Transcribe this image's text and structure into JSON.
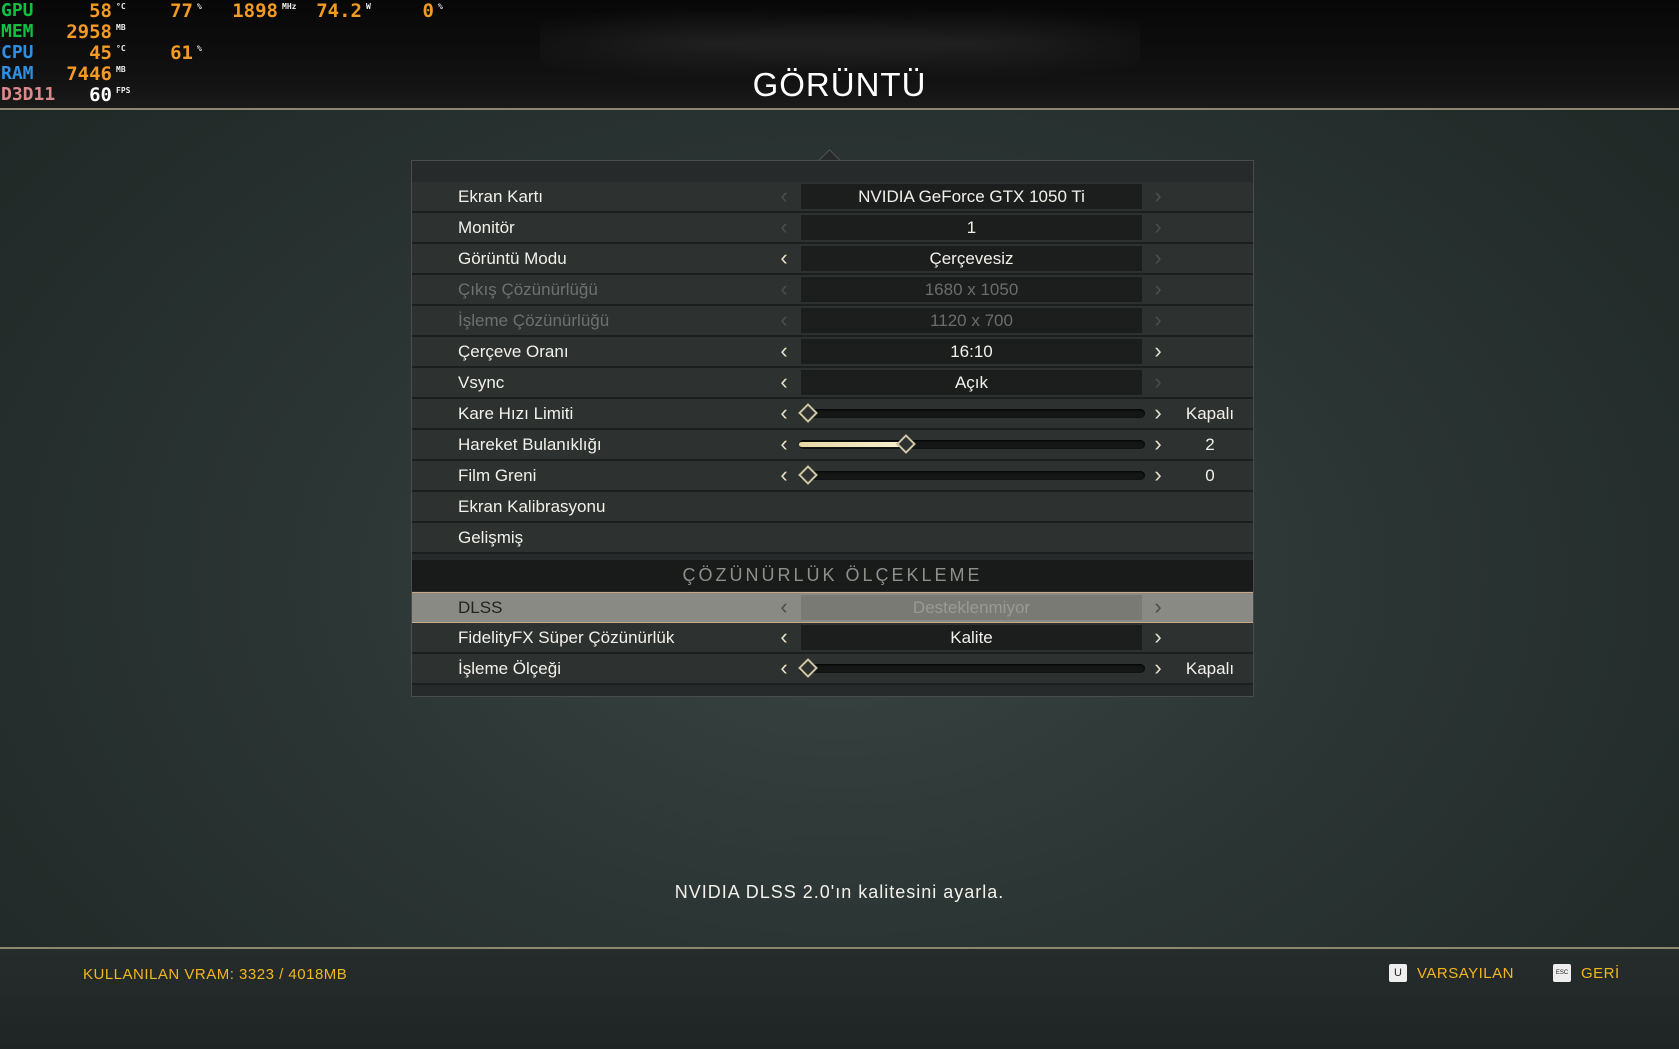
{
  "hud": {
    "rows": [
      {
        "label": "GPU",
        "color": "#10c040",
        "v1": "58",
        "u1": "°C",
        "v2": "77",
        "u2": "%",
        "v3": "1898",
        "u3": "MHz",
        "v4": "74.2",
        "u4": "W",
        "v5": "0",
        "u5": "%"
      },
      {
        "label": "MEM",
        "color": "#10c040",
        "v1": "2958",
        "u1": "MB"
      },
      {
        "label": "CPU",
        "color": "#2f8fe0",
        "v1": "45",
        "u1": "°C",
        "v2": "61",
        "u2": "%"
      },
      {
        "label": "RAM",
        "color": "#2f8fe0",
        "v1": "7446",
        "u1": "MB"
      },
      {
        "label": "D3D11",
        "color": "#d98a8a",
        "v1": "60",
        "u1": "FPS"
      }
    ]
  },
  "header": {
    "title": "GÖRÜNTÜ"
  },
  "settings": [
    {
      "label": "Ekran Kartı",
      "kind": "select",
      "value": "NVIDIA GeForce GTX 1050 Ti",
      "left_enabled": false,
      "right_enabled": false,
      "disabled": false
    },
    {
      "label": "Monitör",
      "kind": "select",
      "value": "1",
      "left_enabled": false,
      "right_enabled": false,
      "disabled": false
    },
    {
      "label": "Görüntü Modu",
      "kind": "select",
      "value": "Çerçevesiz",
      "left_enabled": true,
      "right_enabled": false,
      "disabled": false
    },
    {
      "label": "Çıkış Çözünürlüğü",
      "kind": "select",
      "value": "1680 x 1050",
      "left_enabled": false,
      "right_enabled": false,
      "disabled": true
    },
    {
      "label": "İşleme Çözünürlüğü",
      "kind": "select",
      "value": "1120 x 700",
      "left_enabled": false,
      "right_enabled": false,
      "disabled": true
    },
    {
      "label": "Çerçeve Oranı",
      "kind": "select",
      "value": "16:10",
      "left_enabled": true,
      "right_enabled": true,
      "disabled": false
    },
    {
      "label": "Vsync",
      "kind": "select",
      "value": "Açık",
      "left_enabled": true,
      "right_enabled": false,
      "disabled": false
    },
    {
      "label": "Kare Hızı Limiti",
      "kind": "slider",
      "level": 0.0,
      "value": "Kapalı",
      "left_enabled": true,
      "right_enabled": true,
      "disabled": false
    },
    {
      "label": "Hareket Bulanıklığı",
      "kind": "slider",
      "level": 0.3,
      "value": "2",
      "left_enabled": true,
      "right_enabled": true,
      "disabled": false
    },
    {
      "label": "Film Greni",
      "kind": "slider",
      "level": 0.0,
      "value": "0",
      "left_enabled": true,
      "right_enabled": true,
      "disabled": false
    },
    {
      "label": "Ekran Kalibrasyonu",
      "kind": "link"
    },
    {
      "label": "Gelişmiş",
      "kind": "link"
    }
  ],
  "section": {
    "title": "ÇÖZÜNÜRLÜK ÖLÇEKLEME"
  },
  "scaling": [
    {
      "label": "DLSS",
      "kind": "select",
      "value": "Desteklenmiyor",
      "left_enabled": false,
      "right_enabled": false,
      "disabled": false,
      "selected": true
    },
    {
      "label": "FidelityFX Süper Çözünürlük",
      "kind": "select",
      "value": "Kalite",
      "left_enabled": true,
      "right_enabled": true,
      "disabled": false
    },
    {
      "label": "İşleme Ölçeği",
      "kind": "slider",
      "level": 0.0,
      "value": "Kapalı",
      "left_enabled": true,
      "right_enabled": true,
      "disabled": false
    }
  ],
  "hint": "NVIDIA DLSS 2.0'ın kalitesini ayarla.",
  "footer": {
    "vram": "KULLANILAN VRAM: 3323 / 4018MB",
    "default_key": "U",
    "default_label": "VARSAYILAN",
    "back_key": "ESC",
    "back_label": "GERİ"
  }
}
